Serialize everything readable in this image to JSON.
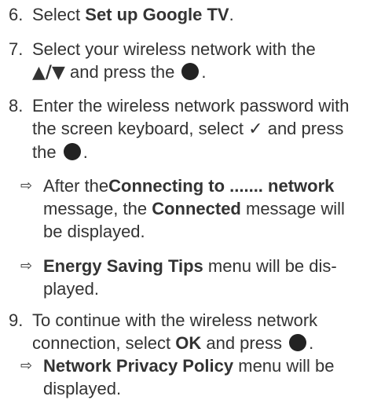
{
  "steps": {
    "s6": {
      "num": "6.",
      "a": "Select ",
      "b": "Set up Google TV",
      "c": "."
    },
    "s7": {
      "num": "7.",
      "a": "Select your wireless network with the",
      "arrows": "▲/▼",
      "b": " and press the ",
      "c": "."
    },
    "s8": {
      "num": "8.",
      "a": "Enter the wireless network password with the screen keyboard, select ",
      "check": "✓",
      "b": " and press the ",
      "c": "."
    },
    "s9": {
      "num": "9.",
      "a": "To continue with the wireless network connection, select ",
      "b": "OK",
      "c": " and press ",
      "d": "."
    }
  },
  "subs": {
    "arrow": "⇨",
    "sub1": {
      "a": "After the",
      "b": "Connecting to ....... network",
      "c": " message, the ",
      "d": "Connected",
      "e": " message will be displayed."
    },
    "sub2": {
      "b": "Energy Saving Tips",
      "c": " menu will be dis-played."
    },
    "sub3": {
      "b": "Network Privacy Policy",
      "c": " menu will be displayed."
    }
  },
  "icons": {
    "button_icon": "filled-circle-button-icon"
  }
}
